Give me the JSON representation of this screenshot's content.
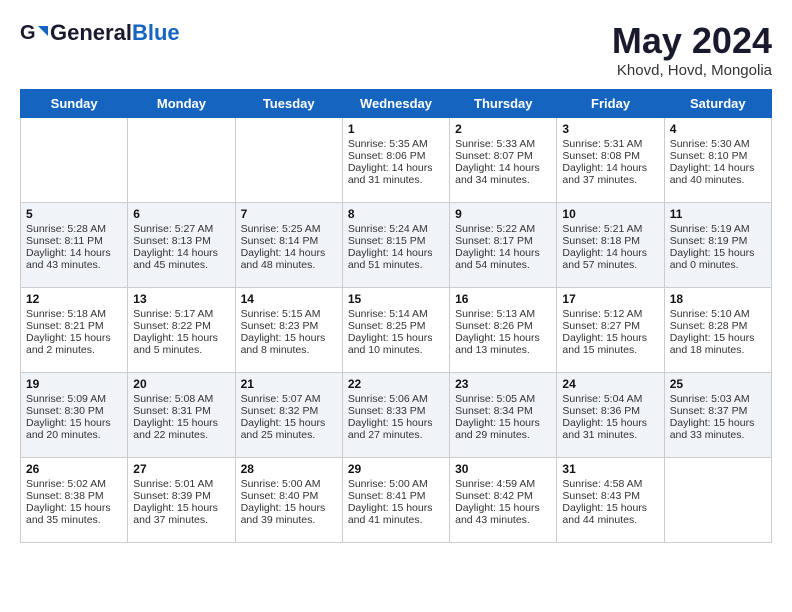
{
  "header": {
    "logo_general": "General",
    "logo_blue": "Blue",
    "month": "May 2024",
    "location": "Khovd, Hovd, Mongolia"
  },
  "days_of_week": [
    "Sunday",
    "Monday",
    "Tuesday",
    "Wednesday",
    "Thursday",
    "Friday",
    "Saturday"
  ],
  "weeks": [
    [
      {
        "day": "",
        "sunrise": "",
        "sunset": "",
        "daylight": ""
      },
      {
        "day": "",
        "sunrise": "",
        "sunset": "",
        "daylight": ""
      },
      {
        "day": "",
        "sunrise": "",
        "sunset": "",
        "daylight": ""
      },
      {
        "day": "1",
        "sunrise": "Sunrise: 5:35 AM",
        "sunset": "Sunset: 8:06 PM",
        "daylight": "Daylight: 14 hours and 31 minutes."
      },
      {
        "day": "2",
        "sunrise": "Sunrise: 5:33 AM",
        "sunset": "Sunset: 8:07 PM",
        "daylight": "Daylight: 14 hours and 34 minutes."
      },
      {
        "day": "3",
        "sunrise": "Sunrise: 5:31 AM",
        "sunset": "Sunset: 8:08 PM",
        "daylight": "Daylight: 14 hours and 37 minutes."
      },
      {
        "day": "4",
        "sunrise": "Sunrise: 5:30 AM",
        "sunset": "Sunset: 8:10 PM",
        "daylight": "Daylight: 14 hours and 40 minutes."
      }
    ],
    [
      {
        "day": "5",
        "sunrise": "Sunrise: 5:28 AM",
        "sunset": "Sunset: 8:11 PM",
        "daylight": "Daylight: 14 hours and 43 minutes."
      },
      {
        "day": "6",
        "sunrise": "Sunrise: 5:27 AM",
        "sunset": "Sunset: 8:13 PM",
        "daylight": "Daylight: 14 hours and 45 minutes."
      },
      {
        "day": "7",
        "sunrise": "Sunrise: 5:25 AM",
        "sunset": "Sunset: 8:14 PM",
        "daylight": "Daylight: 14 hours and 48 minutes."
      },
      {
        "day": "8",
        "sunrise": "Sunrise: 5:24 AM",
        "sunset": "Sunset: 8:15 PM",
        "daylight": "Daylight: 14 hours and 51 minutes."
      },
      {
        "day": "9",
        "sunrise": "Sunrise: 5:22 AM",
        "sunset": "Sunset: 8:17 PM",
        "daylight": "Daylight: 14 hours and 54 minutes."
      },
      {
        "day": "10",
        "sunrise": "Sunrise: 5:21 AM",
        "sunset": "Sunset: 8:18 PM",
        "daylight": "Daylight: 14 hours and 57 minutes."
      },
      {
        "day": "11",
        "sunrise": "Sunrise: 5:19 AM",
        "sunset": "Sunset: 8:19 PM",
        "daylight": "Daylight: 15 hours and 0 minutes."
      }
    ],
    [
      {
        "day": "12",
        "sunrise": "Sunrise: 5:18 AM",
        "sunset": "Sunset: 8:21 PM",
        "daylight": "Daylight: 15 hours and 2 minutes."
      },
      {
        "day": "13",
        "sunrise": "Sunrise: 5:17 AM",
        "sunset": "Sunset: 8:22 PM",
        "daylight": "Daylight: 15 hours and 5 minutes."
      },
      {
        "day": "14",
        "sunrise": "Sunrise: 5:15 AM",
        "sunset": "Sunset: 8:23 PM",
        "daylight": "Daylight: 15 hours and 8 minutes."
      },
      {
        "day": "15",
        "sunrise": "Sunrise: 5:14 AM",
        "sunset": "Sunset: 8:25 PM",
        "daylight": "Daylight: 15 hours and 10 minutes."
      },
      {
        "day": "16",
        "sunrise": "Sunrise: 5:13 AM",
        "sunset": "Sunset: 8:26 PM",
        "daylight": "Daylight: 15 hours and 13 minutes."
      },
      {
        "day": "17",
        "sunrise": "Sunrise: 5:12 AM",
        "sunset": "Sunset: 8:27 PM",
        "daylight": "Daylight: 15 hours and 15 minutes."
      },
      {
        "day": "18",
        "sunrise": "Sunrise: 5:10 AM",
        "sunset": "Sunset: 8:28 PM",
        "daylight": "Daylight: 15 hours and 18 minutes."
      }
    ],
    [
      {
        "day": "19",
        "sunrise": "Sunrise: 5:09 AM",
        "sunset": "Sunset: 8:30 PM",
        "daylight": "Daylight: 15 hours and 20 minutes."
      },
      {
        "day": "20",
        "sunrise": "Sunrise: 5:08 AM",
        "sunset": "Sunset: 8:31 PM",
        "daylight": "Daylight: 15 hours and 22 minutes."
      },
      {
        "day": "21",
        "sunrise": "Sunrise: 5:07 AM",
        "sunset": "Sunset: 8:32 PM",
        "daylight": "Daylight: 15 hours and 25 minutes."
      },
      {
        "day": "22",
        "sunrise": "Sunrise: 5:06 AM",
        "sunset": "Sunset: 8:33 PM",
        "daylight": "Daylight: 15 hours and 27 minutes."
      },
      {
        "day": "23",
        "sunrise": "Sunrise: 5:05 AM",
        "sunset": "Sunset: 8:34 PM",
        "daylight": "Daylight: 15 hours and 29 minutes."
      },
      {
        "day": "24",
        "sunrise": "Sunrise: 5:04 AM",
        "sunset": "Sunset: 8:36 PM",
        "daylight": "Daylight: 15 hours and 31 minutes."
      },
      {
        "day": "25",
        "sunrise": "Sunrise: 5:03 AM",
        "sunset": "Sunset: 8:37 PM",
        "daylight": "Daylight: 15 hours and 33 minutes."
      }
    ],
    [
      {
        "day": "26",
        "sunrise": "Sunrise: 5:02 AM",
        "sunset": "Sunset: 8:38 PM",
        "daylight": "Daylight: 15 hours and 35 minutes."
      },
      {
        "day": "27",
        "sunrise": "Sunrise: 5:01 AM",
        "sunset": "Sunset: 8:39 PM",
        "daylight": "Daylight: 15 hours and 37 minutes."
      },
      {
        "day": "28",
        "sunrise": "Sunrise: 5:00 AM",
        "sunset": "Sunset: 8:40 PM",
        "daylight": "Daylight: 15 hours and 39 minutes."
      },
      {
        "day": "29",
        "sunrise": "Sunrise: 5:00 AM",
        "sunset": "Sunset: 8:41 PM",
        "daylight": "Daylight: 15 hours and 41 minutes."
      },
      {
        "day": "30",
        "sunrise": "Sunrise: 4:59 AM",
        "sunset": "Sunset: 8:42 PM",
        "daylight": "Daylight: 15 hours and 43 minutes."
      },
      {
        "day": "31",
        "sunrise": "Sunrise: 4:58 AM",
        "sunset": "Sunset: 8:43 PM",
        "daylight": "Daylight: 15 hours and 44 minutes."
      },
      {
        "day": "",
        "sunrise": "",
        "sunset": "",
        "daylight": ""
      }
    ]
  ]
}
